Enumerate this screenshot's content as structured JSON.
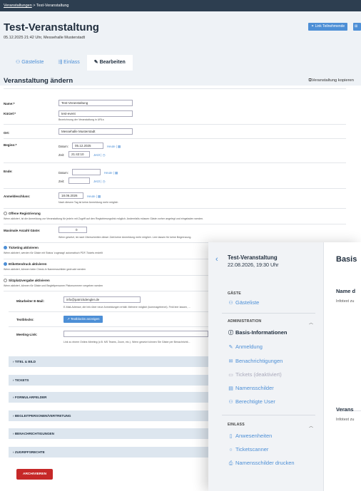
{
  "breadcrumb": {
    "link": "Veranstaltungen",
    "current": " > Test-Veranstaltung"
  },
  "header": {
    "title": "Test-Veranstaltung",
    "subtitle": "05.12.2025 21:42 Uhr, Messehalle Musterstadt",
    "link_button": "Link Teilnehmende"
  },
  "tabs": [
    {
      "label": "Gästeliste",
      "icon": "users-icon"
    },
    {
      "label": "Einlass",
      "icon": "door-icon"
    },
    {
      "label": "Bearbeiten",
      "icon": "edit-icon"
    }
  ],
  "form": {
    "title": "Veranstaltung ändern",
    "copy": "Veranstaltung kopieren",
    "name_label": "Name:*",
    "name_value": "Test-Veranstaltung",
    "kuerzel_label": "Kürzel:*",
    "kuerzel_value": "test-event",
    "kuerzel_hint": "Bezeichnung der Veranstaltung in URLs",
    "ort_label": "Ort:",
    "ort_value": "Messehalle Musterstadt",
    "beginn_label": "Beginn:*",
    "datum_label": "Datum:",
    "beginn_datum": "05.12.2025",
    "zeit_label": "Zeit:",
    "beginn_zeit": "21:42:10",
    "heute": "Heute",
    "jetzt": "Jetzt",
    "ende_label": "Ende:",
    "ende_datum": "",
    "ende_zeit": "",
    "anmeldeschluss_label": "Anmeldeschluss:",
    "anmeldeschluss_value": "18.06.2026",
    "anmeldeschluss_hint": "Nach diesem Tag ist keine Anmeldung mehr möglich",
    "offene_label": "Offene Registrierung",
    "offene_desc": "Wenn aktiviert, ist die Anmeldung zur Veranstaltung für jede/n mit Zugriff auf den Registrierungslink möglich. Andernfalls müssen Gäste vorher angelegt und eingeladen werden.",
    "max_label": "Maximale Anzahl Gäste:",
    "max_value": "0",
    "max_hint": "Wenn gesetzt, ist nach Überschreiten dieser Zahl keine Anmeldung mehr möglich. Leer lassen für keine Begrenzung.",
    "ticketing_label": "Ticketing aktivieren",
    "ticketing_desc": "Wenn aktiviert, werden für Gäste mit Status 'zugesagt' automatisch PDF-Tickets erstellt",
    "etiketten_label": "Etikettendruck aktivieren",
    "etiketten_desc": "Wenn aktiviert, können beim Check-In Namensschilder gedruckt werden",
    "sitzplatz_label": "Sitzplatzvergabe aktivieren",
    "sitzplatz_desc": "Wenn aktiviert, können für Gäste und Begleitpersonen Platznummern vergeben werden",
    "mail_label": "Mitarbeiter E-Mail:",
    "mail_value": "info@patrickdengler.de",
    "mail_hint": "E-Mail-Adresse, die Info über neue Anmeldungen erhält. Mehrere möglich (kommagetrennt). Feld leer lassen, ...",
    "textblocks_label": "Textblocks:",
    "textblocks_button": "Textblocks anzeigen",
    "meeting_label": "Meeting-Link:",
    "meeting_value": "",
    "meeting_hint": "Link zu einem Online-Meeting (z.B. MS Teams, Zoom, etc.). Wenn gesetzt können Sie Gäste per Benachrichti..."
  },
  "accordions": [
    "TITEL & BILD",
    "TICKETS",
    "FORMULARFELDER",
    "BEGLEITPERSONEN/VERTRETUNG",
    "BENACHRICHTIGUNGEN",
    "ZUGRIFFSRECHTE"
  ],
  "archive_button": "ARCHIVIEREN",
  "panel": {
    "title": "Test-Veranstaltung",
    "date": "22.08.2026, 19:30 Uhr",
    "section_gaeste": "GÄSTE",
    "gaesteliste": "Gästeliste",
    "section_admin": "ADMINISTRATION",
    "admin_items": [
      {
        "label": "Basis-Informationen",
        "icon": "info-icon",
        "state": "active"
      },
      {
        "label": "Anmeldung",
        "icon": "edit-icon",
        "state": "normal"
      },
      {
        "label": "Benachrichtigungen",
        "icon": "mail-icon",
        "state": "normal"
      },
      {
        "label": "Tickets (deaktiviert)",
        "icon": "ticket-icon",
        "state": "disabled"
      },
      {
        "label": "Namensschilder",
        "icon": "id-card-icon",
        "state": "normal"
      },
      {
        "label": "Berechtigte User",
        "icon": "users-icon",
        "state": "normal"
      }
    ],
    "section_einlass": "EINLASS",
    "einlass_items": [
      {
        "label": "Anwesenheiten",
        "icon": "clipboard-icon"
      },
      {
        "label": "Ticketscanner",
        "icon": "search-icon"
      },
      {
        "label": "Namensschilder drucken",
        "icon": "printer-icon"
      }
    ]
  },
  "right": {
    "title": "Basis",
    "name_head": "Name d",
    "name_text": "Infotext zu",
    "vera_head": "Verans",
    "vera_text": "Infotext zu"
  }
}
